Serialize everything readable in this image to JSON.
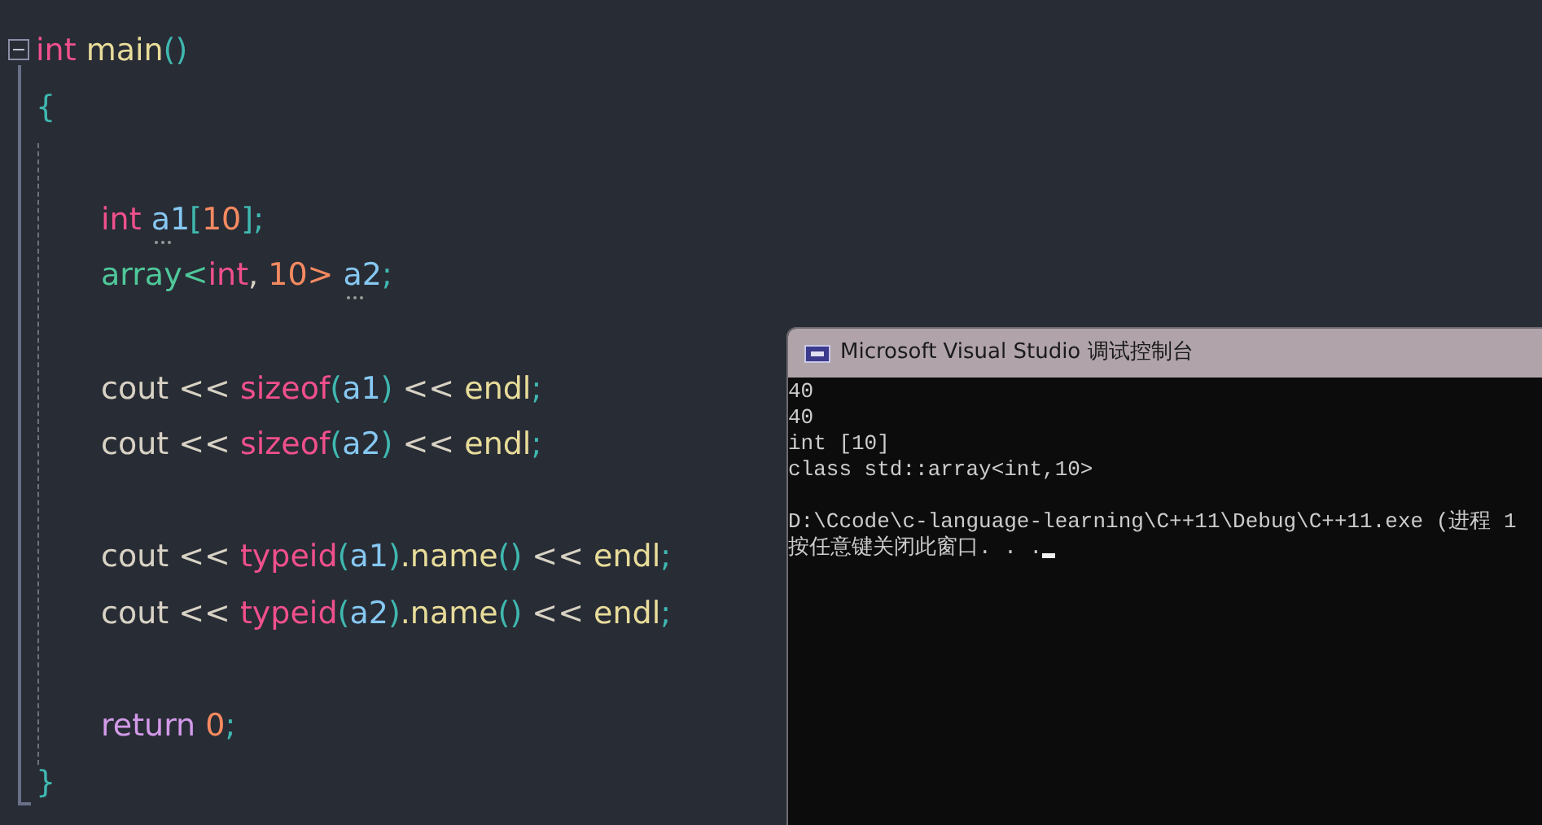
{
  "editor": {
    "function": {
      "header": [
        {
          "kind": "keyword",
          "text": "int "
        },
        {
          "kind": "function",
          "text": "main"
        },
        {
          "kind": "paren",
          "text": "()"
        }
      ],
      "open": "{",
      "body": [
        {
          "kind": "blank"
        },
        {
          "kind": "code",
          "tokens": [
            {
              "kind": "keyword",
              "text": "int "
            },
            {
              "kind": "variable",
              "text": "a1",
              "hint": true
            },
            {
              "kind": "paren",
              "text": "["
            },
            {
              "kind": "number",
              "text": "10"
            },
            {
              "kind": "paren",
              "text": "];"
            }
          ]
        },
        {
          "kind": "code",
          "tokens": [
            {
              "kind": "type",
              "text": "array<"
            },
            {
              "kind": "keyword",
              "text": "int"
            },
            {
              "kind": "plain",
              "text": ", "
            },
            {
              "kind": "number",
              "text": "10> "
            },
            {
              "kind": "variable",
              "text": "a2",
              "hint": true
            },
            {
              "kind": "paren",
              "text": ";"
            }
          ]
        },
        {
          "kind": "blank"
        },
        {
          "kind": "code",
          "tokens": [
            {
              "kind": "plain",
              "text": "cout << "
            },
            {
              "kind": "keyword",
              "text": "sizeof"
            },
            {
              "kind": "paren",
              "text": "("
            },
            {
              "kind": "variable",
              "text": "a1"
            },
            {
              "kind": "paren",
              "text": ")"
            },
            {
              "kind": "plain",
              "text": " << "
            },
            {
              "kind": "function",
              "text": "endl"
            },
            {
              "kind": "paren",
              "text": ";"
            }
          ]
        },
        {
          "kind": "code",
          "tokens": [
            {
              "kind": "plain",
              "text": "cout << "
            },
            {
              "kind": "keyword",
              "text": "sizeof"
            },
            {
              "kind": "paren",
              "text": "("
            },
            {
              "kind": "variable",
              "text": "a2"
            },
            {
              "kind": "paren",
              "text": ")"
            },
            {
              "kind": "plain",
              "text": " << "
            },
            {
              "kind": "function",
              "text": "endl"
            },
            {
              "kind": "paren",
              "text": ";"
            }
          ]
        },
        {
          "kind": "blank"
        },
        {
          "kind": "code",
          "tokens": [
            {
              "kind": "plain",
              "text": "cout << "
            },
            {
              "kind": "keyword",
              "text": "typeid"
            },
            {
              "kind": "paren",
              "text": "("
            },
            {
              "kind": "variable",
              "text": "a1"
            },
            {
              "kind": "paren",
              "text": ")"
            },
            {
              "kind": "function",
              "text": ".name"
            },
            {
              "kind": "paren",
              "text": "()"
            },
            {
              "kind": "plain",
              "text": " << "
            },
            {
              "kind": "function",
              "text": "endl"
            },
            {
              "kind": "paren",
              "text": ";"
            }
          ]
        },
        {
          "kind": "code",
          "tokens": [
            {
              "kind": "plain",
              "text": "cout << "
            },
            {
              "kind": "keyword",
              "text": "typeid"
            },
            {
              "kind": "paren",
              "text": "("
            },
            {
              "kind": "variable",
              "text": "a2"
            },
            {
              "kind": "paren",
              "text": ")"
            },
            {
              "kind": "function",
              "text": ".name"
            },
            {
              "kind": "paren",
              "text": "()"
            },
            {
              "kind": "plain",
              "text": " << "
            },
            {
              "kind": "function",
              "text": "endl"
            },
            {
              "kind": "paren",
              "text": ";"
            }
          ]
        },
        {
          "kind": "blank"
        },
        {
          "kind": "code",
          "tokens": [
            {
              "kind": "control",
              "text": "return "
            },
            {
              "kind": "number",
              "text": "0"
            },
            {
              "kind": "paren",
              "text": ";"
            }
          ]
        }
      ],
      "close": "}"
    }
  },
  "console": {
    "title": "Microsoft Visual Studio 调试控制台",
    "output": [
      "40",
      "40",
      "int [10]",
      "class std::array<int,10>"
    ],
    "exit_lines": [
      "D:\\Ccode\\c-language-learning\\C++11\\Debug\\C++11.exe (进程 1",
      "按任意键关闭此窗口. . ."
    ],
    "cursor": true
  }
}
